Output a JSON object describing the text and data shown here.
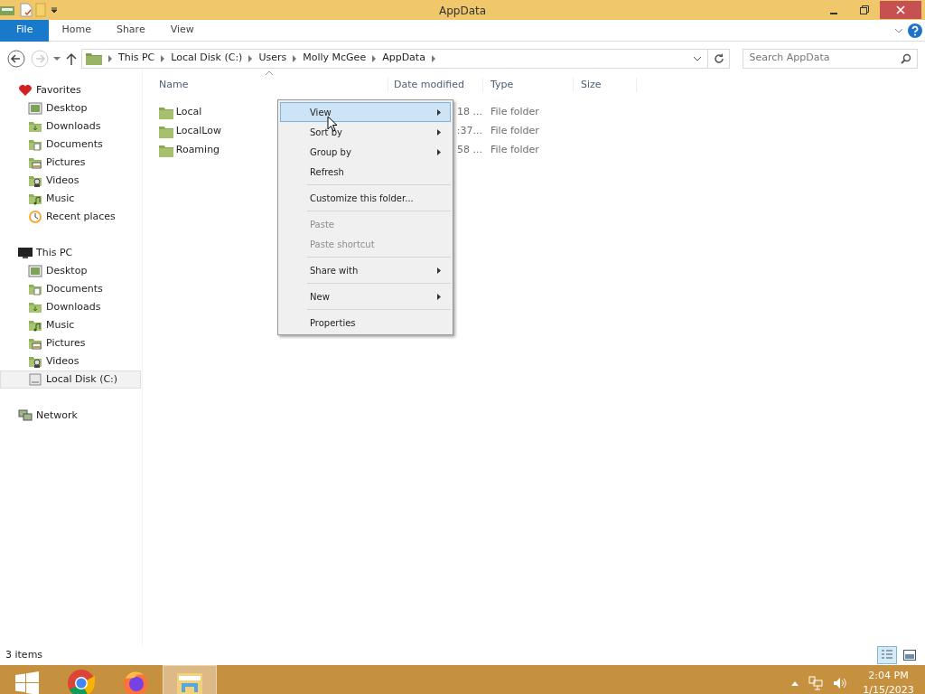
{
  "window": {
    "title": "AppData"
  },
  "ribbon": {
    "tabs": [
      {
        "label": "File",
        "kind": "file"
      },
      {
        "label": "Home",
        "kind": "tab"
      },
      {
        "label": "Share",
        "kind": "tab"
      },
      {
        "label": "View",
        "kind": "tab"
      }
    ]
  },
  "address_bar": {
    "crumbs": [
      "This PC",
      "Local Disk (C:)",
      "Users",
      "Molly McGee",
      "AppData"
    ]
  },
  "search": {
    "placeholder": "Search AppData"
  },
  "navigation": [
    {
      "label": "Favorites",
      "kind": "favorites",
      "children": [
        {
          "label": "Desktop",
          "kind": "desktop",
          "selected": false
        },
        {
          "label": "Downloads",
          "kind": "downloads",
          "selected": false
        },
        {
          "label": "Documents",
          "kind": "documents",
          "selected": false
        },
        {
          "label": "Pictures",
          "kind": "pictures",
          "selected": false
        },
        {
          "label": "Videos",
          "kind": "videos",
          "selected": false
        },
        {
          "label": "Music",
          "kind": "music",
          "selected": false
        },
        {
          "label": "Recent places",
          "kind": "recent",
          "selected": false
        }
      ]
    },
    {
      "label": "This PC",
      "kind": "pc",
      "children": [
        {
          "label": "Desktop",
          "kind": "desktop",
          "selected": false
        },
        {
          "label": "Documents",
          "kind": "documents",
          "selected": false
        },
        {
          "label": "Downloads",
          "kind": "downloads",
          "selected": false
        },
        {
          "label": "Music",
          "kind": "music",
          "selected": false
        },
        {
          "label": "Pictures",
          "kind": "pictures",
          "selected": false
        },
        {
          "label": "Videos",
          "kind": "videos",
          "selected": false
        },
        {
          "label": "Local Disk (C:)",
          "kind": "disk",
          "selected": true
        }
      ]
    },
    {
      "label": "Network",
      "kind": "network"
    }
  ],
  "table": {
    "columns": [
      "Name",
      "Date modified",
      "Type",
      "Size"
    ],
    "rows": [
      {
        "name": "Local",
        "date": "18 ...",
        "type": "File folder"
      },
      {
        "name": "LocalLow",
        "date": ":37...",
        "type": "File folder"
      },
      {
        "name": "Roaming",
        "date": "58 ...",
        "type": "File folder"
      }
    ]
  },
  "context_menu": [
    {
      "kind": "item",
      "label": "View",
      "submenu": true,
      "disabled": false,
      "selected": true
    },
    {
      "kind": "item",
      "label": "Sort by",
      "submenu": true,
      "disabled": false,
      "selected": false
    },
    {
      "kind": "item",
      "label": "Group by",
      "submenu": true,
      "disabled": false,
      "selected": false
    },
    {
      "kind": "item",
      "label": "Refresh",
      "submenu": false,
      "disabled": false,
      "selected": false
    },
    {
      "kind": "separator"
    },
    {
      "kind": "item",
      "label": "Customize this folder...",
      "submenu": false,
      "disabled": false,
      "selected": false
    },
    {
      "kind": "separator"
    },
    {
      "kind": "item",
      "label": "Paste",
      "submenu": false,
      "disabled": true,
      "selected": false
    },
    {
      "kind": "item",
      "label": "Paste shortcut",
      "submenu": false,
      "disabled": true,
      "selected": false
    },
    {
      "kind": "separator"
    },
    {
      "kind": "item",
      "label": "Share with",
      "submenu": true,
      "disabled": false,
      "selected": false
    },
    {
      "kind": "separator"
    },
    {
      "kind": "item",
      "label": "New",
      "submenu": true,
      "disabled": false,
      "selected": false
    },
    {
      "kind": "separator"
    },
    {
      "kind": "item",
      "label": "Properties",
      "submenu": false,
      "disabled": false,
      "selected": false
    }
  ],
  "status_bar": {
    "text": "3 items",
    "views": [
      {
        "kind": "details",
        "selected": true
      },
      {
        "kind": "large",
        "selected": false
      }
    ]
  },
  "taskbar": {
    "apps": [
      {
        "kind": "start",
        "selected": false
      },
      {
        "kind": "chrome",
        "selected": false
      },
      {
        "kind": "firefox",
        "selected": false
      },
      {
        "kind": "explorer",
        "selected": true
      }
    ],
    "time": "2:04 PM",
    "date": "1/15/2023"
  }
}
